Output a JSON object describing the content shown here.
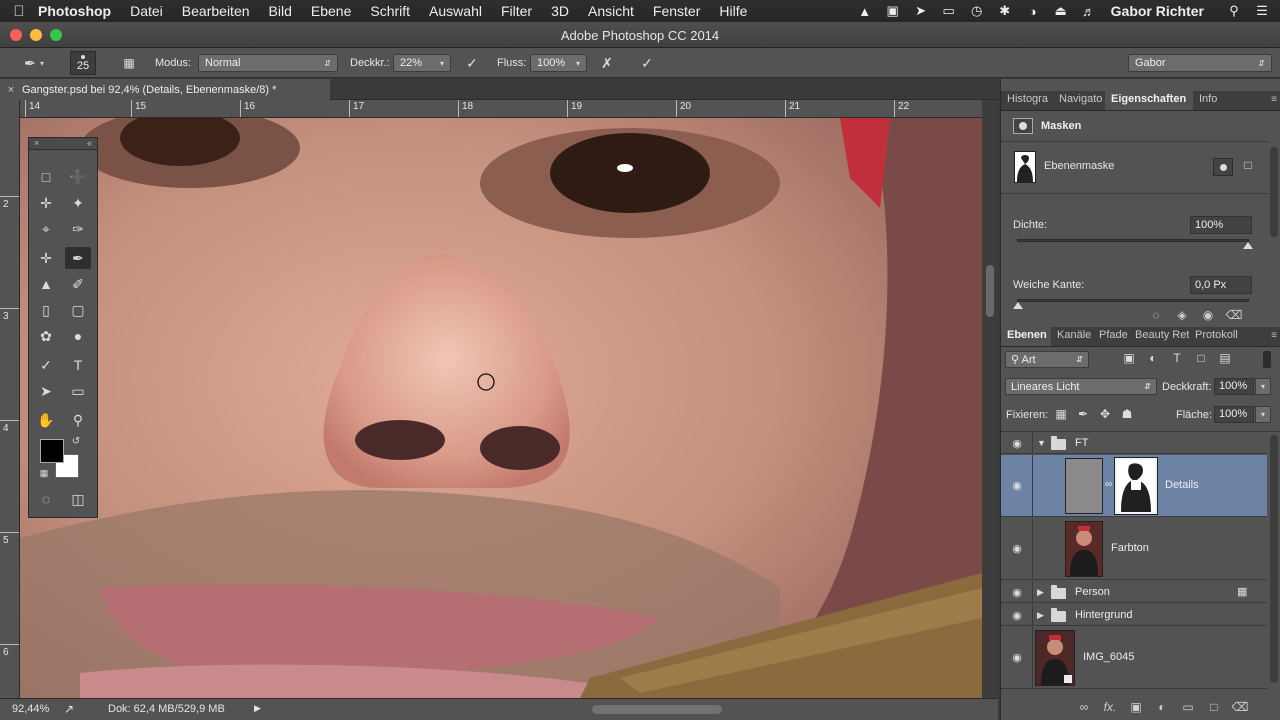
{
  "menubar": {
    "apple": "",
    "app": "Photoshop",
    "items": [
      "Datei",
      "Bearbeiten",
      "Bild",
      "Ebene",
      "Schrift",
      "Auswahl",
      "Filter",
      "3D",
      "Ansicht",
      "Fenster",
      "Hilfe"
    ],
    "user": "Gabor Richter",
    "status_icons": [
      "hat-icon",
      "camera-icon",
      "forward-icon",
      "airplay-icon",
      "time-machine-icon",
      "bluetooth-icon",
      "wifi-icon",
      "eject-icon",
      "volume-icon"
    ]
  },
  "window": {
    "title": "Adobe Photoshop CC 2014",
    "light_colors": [
      "#fc605c",
      "#fdbc40",
      "#34c84a"
    ]
  },
  "options": {
    "brush_size": "25",
    "mode_label": "Modus:",
    "mode_value": "Normal",
    "opacity_label": "Deckkr.:",
    "opacity_value": "22%",
    "flow_label": "Fluss:",
    "flow_value": "100%",
    "workspace": "Gabor"
  },
  "document": {
    "tab_label": "Gangster.psd bei 92,4% (Details, Ebenenmaske/8) *",
    "close_glyph": "×"
  },
  "ruler": {
    "h_labels": [
      "14",
      "15",
      "16",
      "17",
      "18",
      "19",
      "20",
      "21",
      "22"
    ],
    "v_labels": [
      "2",
      "3",
      "4",
      "5",
      "6"
    ]
  },
  "status": {
    "zoom": "92,44%",
    "doc": "Dok: 62,4 MB/529,9 MB"
  },
  "properties_panel": {
    "tabs": [
      "Histogra",
      "Navigato",
      "Eigenschaften",
      "Info"
    ],
    "active_tab": "Eigenschaften",
    "section": "Masken",
    "mask_name": "Ebenenmaske",
    "density_label": "Dichte:",
    "density_value": "100%",
    "density_level": 1.0,
    "feather_label": "Weiche Kante:",
    "feather_value": "0,0 Px",
    "feather_level": 0.0
  },
  "layers_panel": {
    "tabs": [
      "Ebenen",
      "Kanäle",
      "Pfade",
      "Beauty Ret",
      "Protokoll"
    ],
    "active_tab": "Ebenen",
    "filter": "Art",
    "blend_mode": "Lineares Licht",
    "opacity_label": "Deckkraft:",
    "opacity_value": "100%",
    "lock_label": "Fixieren:",
    "fill_label": "Fläche:",
    "fill_value": "100%",
    "layers": [
      {
        "name": "FT",
        "kind": "group-open"
      },
      {
        "name": "Details",
        "kind": "layer-mask",
        "selected": true
      },
      {
        "name": "Farbton",
        "kind": "photo"
      },
      {
        "name": "Person",
        "kind": "group"
      },
      {
        "name": "Hintergrund",
        "kind": "group"
      },
      {
        "name": "IMG_6045",
        "kind": "smart-photo"
      }
    ],
    "accent": "#6d83a6"
  }
}
